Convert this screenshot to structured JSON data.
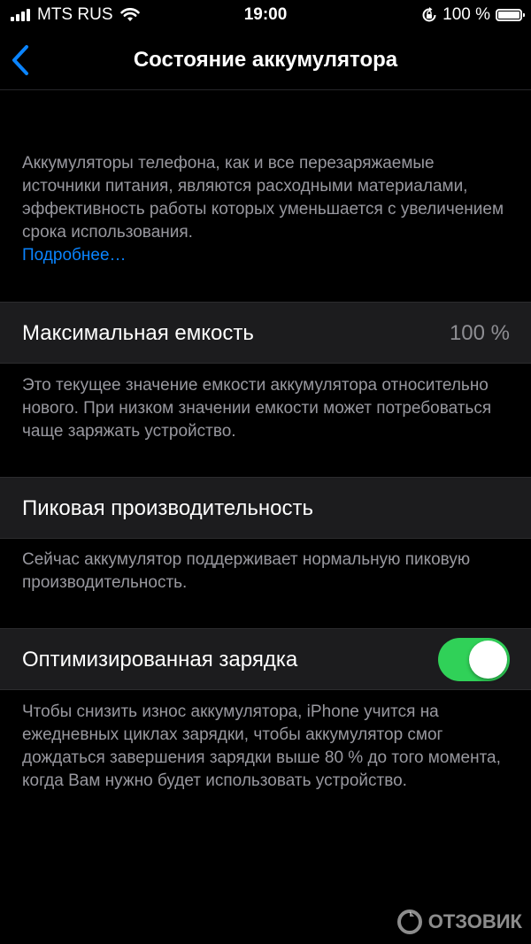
{
  "status_bar": {
    "carrier": "MTS RUS",
    "time": "19:00",
    "battery_percent": "100 %",
    "icons": [
      "signal-icon",
      "wifi-icon",
      "orientation-lock-icon",
      "battery-icon"
    ],
    "battery_level": 1.0
  },
  "nav": {
    "back_icon": "chevron-left-icon",
    "title": "Состояние аккумулятора"
  },
  "intro": {
    "text": "Аккумуляторы телефона, как и все перезаряжаемые источники питания, являются расходными материалами, эффективность работы которых уменьшается с увеличением срока использования.",
    "link_label": "Подробнее…"
  },
  "max_capacity": {
    "label": "Максимальная емкость",
    "value": "100 %",
    "footer": "Это текущее значение емкости аккумулятора относительно нового. При низком значении емкости может потребоваться чаще заряжать устройство."
  },
  "peak_performance": {
    "label": "Пиковая производительность",
    "footer": "Сейчас аккумулятор поддерживает нормальную пиковую производительность."
  },
  "optimized_charging": {
    "label": "Оптимизированная зарядка",
    "enabled": true,
    "footer": "Чтобы снизить износ аккумулятора, iPhone учится на ежедневных циклах зарядки, чтобы аккумулятор смог дождаться завершения зарядки выше 80 % до того момента, когда Вам нужно будет использовать устройство."
  },
  "watermark": {
    "text": "ОТЗОВИК"
  },
  "colors": {
    "background": "#000000",
    "cell": "#1c1c1e",
    "secondary_text": "#98989f",
    "link": "#0a84ff",
    "toggle_on": "#30d158"
  }
}
